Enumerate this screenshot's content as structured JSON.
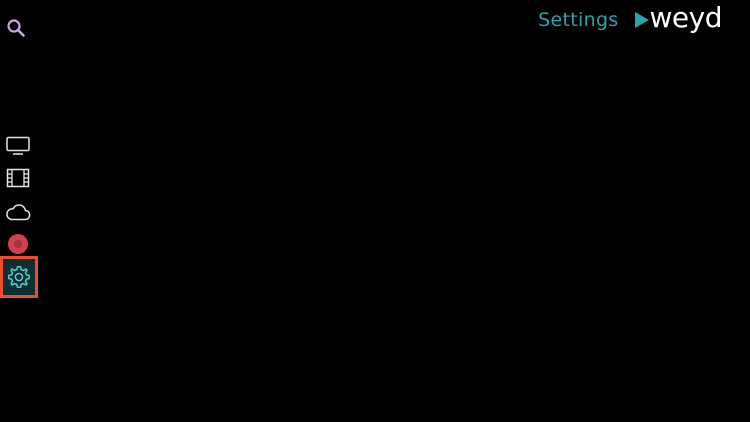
{
  "header": {
    "title": "Settings",
    "logo_text": "weyd"
  },
  "search": {
    "icon": "search-icon"
  },
  "sidebar": {
    "items": [
      {
        "icon": "tv-icon",
        "selected": false
      },
      {
        "icon": "film-icon",
        "selected": false
      },
      {
        "icon": "cloud-icon",
        "selected": false
      },
      {
        "icon": "record-icon",
        "selected": false
      },
      {
        "icon": "gear-icon",
        "selected": true
      }
    ]
  },
  "colors": {
    "background": "#000000",
    "accent": "#2aa3ad",
    "search_icon": "#c8a6e8",
    "sidebar_icon": "#e6e6e6",
    "selection_border": "#ee4d2d",
    "selection_fill": "#0e2e32",
    "record_icon": "#d0404f"
  }
}
